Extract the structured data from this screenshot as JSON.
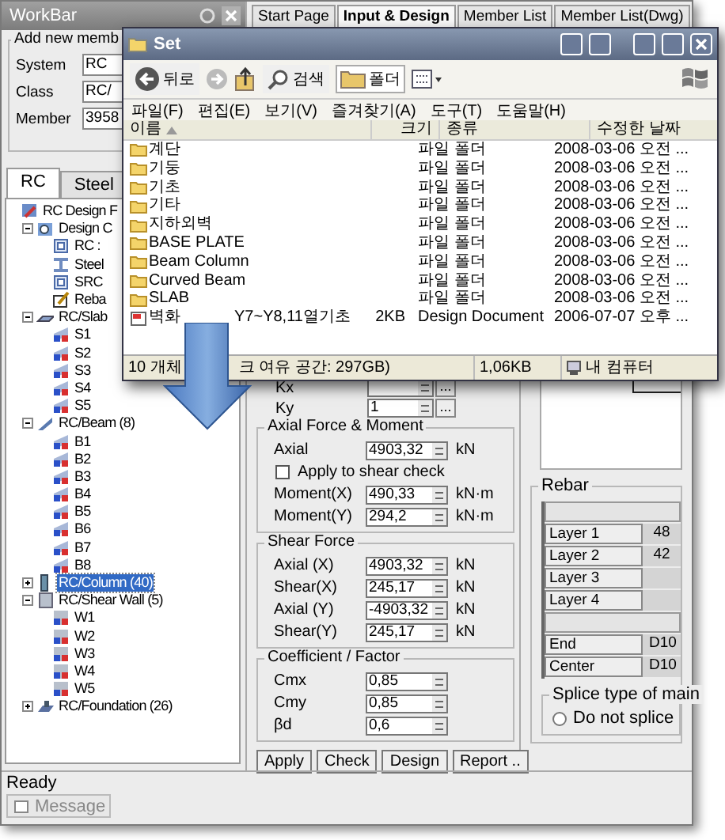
{
  "workbar": {
    "title": "WorkBar",
    "group_title": "Add new memb",
    "fields": [
      {
        "label": "System",
        "value": "RC"
      },
      {
        "label": "Class",
        "value": "RC/"
      },
      {
        "label": "Member",
        "value": "3958"
      }
    ],
    "tabs": [
      {
        "label": "RC",
        "selected": true
      },
      {
        "label": "Steel",
        "selected": false
      }
    ],
    "tree": [
      {
        "label": "RC Design F",
        "kind": "root",
        "selected": false,
        "children": [
          {
            "label": "Design C",
            "kind": "settings",
            "expanded": true,
            "selected": false,
            "children": [
              {
                "label": "RC :",
                "kind": "frame",
                "selected": false
              },
              {
                "label": "Steel",
                "kind": "steel",
                "selected": false
              },
              {
                "label": "SRC",
                "kind": "frame",
                "selected": false
              },
              {
                "label": "Reba",
                "kind": "rebar",
                "selected": false
              }
            ]
          },
          {
            "label": "RC/Slab",
            "kind": "slab",
            "expanded": true,
            "selected": false,
            "children": [
              {
                "label": "S1",
                "kind": "member",
                "selected": false
              },
              {
                "label": "S2",
                "kind": "member",
                "selected": false
              },
              {
                "label": "S3",
                "kind": "member",
                "selected": false
              },
              {
                "label": "S4",
                "kind": "member",
                "selected": false
              },
              {
                "label": "S5",
                "kind": "member",
                "selected": false
              }
            ]
          },
          {
            "label": "RC/Beam (8)",
            "kind": "beam",
            "expanded": true,
            "selected": false,
            "children": [
              {
                "label": "B1",
                "kind": "member",
                "selected": false
              },
              {
                "label": "B2",
                "kind": "member",
                "selected": false
              },
              {
                "label": "B3",
                "kind": "member",
                "selected": false
              },
              {
                "label": "B4",
                "kind": "member",
                "selected": false
              },
              {
                "label": "B5",
                "kind": "member",
                "selected": false
              },
              {
                "label": "B6",
                "kind": "member",
                "selected": false
              },
              {
                "label": "B7",
                "kind": "member",
                "selected": false
              },
              {
                "label": "B8",
                "kind": "member",
                "selected": false
              }
            ]
          },
          {
            "label": "RC/Column (40)",
            "kind": "column",
            "expanded": false,
            "selected": true
          },
          {
            "label": "RC/Shear Wall (5)",
            "kind": "wall",
            "expanded": true,
            "selected": false,
            "children": [
              {
                "label": "W1",
                "kind": "wallmember",
                "selected": false
              },
              {
                "label": "W2",
                "kind": "wallmember",
                "selected": false
              },
              {
                "label": "W3",
                "kind": "wallmember",
                "selected": false
              },
              {
                "label": "W4",
                "kind": "wallmember",
                "selected": false
              },
              {
                "label": "W5",
                "kind": "wallmember",
                "selected": false
              }
            ]
          },
          {
            "label": "RC/Foundation (26)",
            "kind": "foundation",
            "expanded": false,
            "selected": false
          }
        ]
      }
    ]
  },
  "main_tabs": [
    {
      "label": "Start Page",
      "selected": false
    },
    {
      "label": "Input & Design",
      "selected": true
    },
    {
      "label": "Member List",
      "selected": false
    },
    {
      "label": "Member List(Dwg)",
      "selected": false
    }
  ],
  "form": {
    "k_rows": [
      {
        "label": "Kx",
        "browse": "..."
      },
      {
        "label": "Ky",
        "value": "1",
        "browse": "..."
      }
    ],
    "groups": [
      {
        "title": "Axial Force & Moment",
        "rows": [
          {
            "kind": "field",
            "label": "Axial",
            "value": "4903,32",
            "unit": "kN"
          },
          {
            "kind": "checkbox",
            "label": "Apply to shear check",
            "checked": false
          },
          {
            "kind": "field",
            "label": "Moment(X)",
            "value": "490,33",
            "unit": "kN·m"
          },
          {
            "kind": "field",
            "label": "Moment(Y)",
            "value": "294,2",
            "unit": "kN·m"
          }
        ]
      },
      {
        "title": "Shear Force",
        "rows": [
          {
            "kind": "field",
            "label": "Axial (X)",
            "value": "4903,32",
            "unit": "kN"
          },
          {
            "kind": "field",
            "label": "Shear(X)",
            "value": "245,17",
            "unit": "kN"
          },
          {
            "kind": "field",
            "label": "Axial (Y)",
            "value": "-4903,32",
            "unit": "kN"
          },
          {
            "kind": "field",
            "label": "Shear(Y)",
            "value": "245,17",
            "unit": "kN"
          }
        ]
      },
      {
        "title": "Coefficient / Factor",
        "rows": [
          {
            "kind": "field",
            "label": "Cmx",
            "value": "0,85"
          },
          {
            "kind": "field",
            "label": "Cmy",
            "value": "0,85"
          },
          {
            "kind": "field",
            "label": "βd",
            "value": "0,6"
          }
        ]
      }
    ],
    "buttons": [
      "Apply",
      "Check",
      "Design",
      "Report .."
    ]
  },
  "rebar": {
    "title": "Rebar",
    "rows": [
      {
        "kind": "blank"
      },
      {
        "kind": "layer",
        "label": "Layer 1",
        "value": "48"
      },
      {
        "kind": "layer",
        "label": "Layer 2",
        "value": "42"
      },
      {
        "kind": "layer",
        "label": "Layer 3"
      },
      {
        "kind": "layer",
        "label": "Layer 4"
      },
      {
        "kind": "blank"
      },
      {
        "kind": "bar",
        "label": "End",
        "value": "D10"
      },
      {
        "kind": "bar",
        "label": "Center",
        "value": "D10"
      }
    ]
  },
  "splice": {
    "title": "Splice type of main",
    "options": [
      {
        "label": "Do not splice",
        "selected": false
      }
    ]
  },
  "status": "Ready",
  "message_tab": "Message",
  "explorer": {
    "title": "Set",
    "back": "뒤로",
    "search": "검색",
    "folders": "폴더",
    "folders_pressed": true,
    "menu": [
      "파일(F)",
      "편집(E)",
      "보기(V)",
      "즐겨찾기(A)",
      "도구(T)",
      "도움말(H)"
    ],
    "columns": [
      "이름",
      "크기",
      "종류",
      "수정한 날짜"
    ],
    "rows": [
      {
        "kind": "folder",
        "name": "계단",
        "type": "파일 폴더",
        "modified": "2008-03-06 오전 ..."
      },
      {
        "kind": "folder",
        "name": "기둥",
        "type": "파일 폴더",
        "modified": "2008-03-06 오전 ..."
      },
      {
        "kind": "folder",
        "name": "기초",
        "type": "파일 폴더",
        "modified": "2008-03-06 오전 ..."
      },
      {
        "kind": "folder",
        "name": "기타",
        "type": "파일 폴더",
        "modified": "2008-03-06 오전 ..."
      },
      {
        "kind": "folder",
        "name": "지하외벽",
        "type": "파일 폴더",
        "modified": "2008-03-06 오전 ..."
      },
      {
        "kind": "folder",
        "name": "BASE PLATE",
        "type": "파일 폴더",
        "modified": "2008-03-06 오전 ..."
      },
      {
        "kind": "folder",
        "name": "Beam Column",
        "type": "파일 폴더",
        "modified": "2008-03-06 오전 ..."
      },
      {
        "kind": "folder",
        "name": "Curved Beam",
        "type": "파일 폴더",
        "modified": "2008-03-06 오전 ..."
      },
      {
        "kind": "folder",
        "name": "SLAB",
        "type": "파일 폴더",
        "modified": "2008-03-06 오전 ..."
      },
      {
        "kind": "document",
        "name": "벽화",
        "name_rest": "Y7~Y8,11열기초",
        "size": "2KB",
        "type": "Design Document",
        "modified": "2006-07-07 오후 ..."
      }
    ],
    "status": [
      "10 개체",
      "크 여유 공간: 297GB)",
      "1,06KB",
      "내 컴퓨터"
    ]
  }
}
